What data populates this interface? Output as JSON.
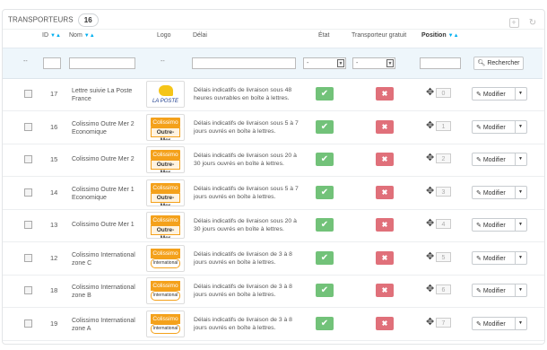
{
  "panel": {
    "title": "TRANSPORTEURS",
    "count": "16"
  },
  "header_icons": [
    "add-icon",
    "refresh-icon"
  ],
  "columns": {
    "id": "ID",
    "name": "Nom",
    "logo": "Logo",
    "delay": "Délai",
    "state": "État",
    "free": "Transporteur gratuit",
    "position": "Position"
  },
  "filters": {
    "id_placeholder": "--",
    "logo_placeholder": "--",
    "state_select": "-",
    "free_select": "-",
    "search_button": "Rechercher"
  },
  "rows": [
    {
      "id": "17",
      "name": "Lettre suivie La Poste France",
      "logo": "laposte",
      "logo_text": "LA POSTE",
      "delay": "Délais indicatifs de livraison sous 48 heures ouvrables en boîte à lettres.",
      "position": "0",
      "action": "Modifier"
    },
    {
      "id": "16",
      "name": "Colissimo Outre Mer 2 Economique",
      "logo": "outremer",
      "logo_top": "Colissimo",
      "logo_bottom": "Outre-Mer",
      "delay": "Délais indicatifs de livraison sous 5 à 7 jours ouvrés en boîte à lettres.",
      "position": "1",
      "action": "Modifier"
    },
    {
      "id": "15",
      "name": "Colissimo Outre Mer 2",
      "logo": "outremer",
      "logo_top": "Colissimo",
      "logo_bottom": "Outre-Mer",
      "delay": "Délais indicatifs de livraison sous 20 à 30 jours ouvrés en boîte à lettres.",
      "position": "2",
      "action": "Modifier"
    },
    {
      "id": "14",
      "name": "Colissimo Outre Mer 1 Economique",
      "logo": "outremer",
      "logo_top": "Colissimo",
      "logo_bottom": "Outre-Mer",
      "delay": "Délais indicatifs de livraison sous 5 à 7 jours ouvrés en boîte à lettres.",
      "position": "3",
      "action": "Modifier"
    },
    {
      "id": "13",
      "name": "Colissimo Outre Mer 1",
      "logo": "outremer",
      "logo_top": "Colissimo",
      "logo_bottom": "Outre-Mer",
      "delay": "Délais indicatifs de livraison sous 20 à 30 jours ouvrés en boîte à lettres.",
      "position": "4",
      "action": "Modifier"
    },
    {
      "id": "12",
      "name": "Colissimo International zone C",
      "logo": "international",
      "logo_top": "Colissimo",
      "logo_bottom": "International",
      "delay": "Délais indicatifs de livraison de 3 à 8 jours ouvrés en boîte à lettres.",
      "position": "5",
      "action": "Modifier"
    },
    {
      "id": "18",
      "name": "Colissimo International zone B",
      "logo": "international",
      "logo_top": "Colissimo",
      "logo_bottom": "International",
      "delay": "Délais indicatifs de livraison de 3 à 8 jours ouvrés en boîte à lettres.",
      "position": "6",
      "action": "Modifier"
    },
    {
      "id": "19",
      "name": "Colissimo International zone A",
      "logo": "international",
      "logo_top": "Colissimo",
      "logo_bottom": "International",
      "delay": "Délais indicatifs de livraison de 3 à 8 jours ouvrés en boîte à lettres.",
      "position": "7",
      "action": "Modifier"
    }
  ],
  "colors": {
    "accent": "#00aff0",
    "enabled": "#72c279",
    "disabled": "#e0707a",
    "colissimo": "#f4a11b"
  }
}
